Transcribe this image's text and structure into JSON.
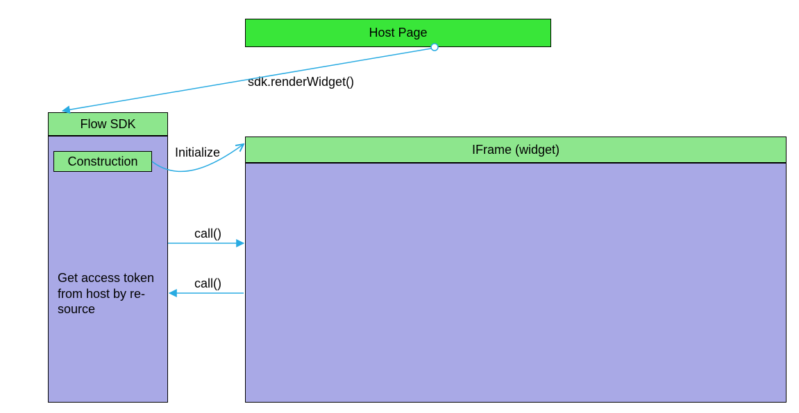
{
  "nodes": {
    "host_page": "Host Page",
    "flow_sdk": "Flow SDK",
    "construction": "Construction",
    "iframe_widget": "IFrame (widget)"
  },
  "edges": {
    "render_widget": "sdk.renderWidget()",
    "initialize": "Initialize",
    "call_out": "call()",
    "call_back": "call()"
  },
  "notes": {
    "access_token": "Get access token from host by re­source"
  },
  "colors": {
    "bright_green": "#39e639",
    "light_green": "#8de68d",
    "lilac": "#a9a9e6",
    "arrow": "#29abe2"
  }
}
